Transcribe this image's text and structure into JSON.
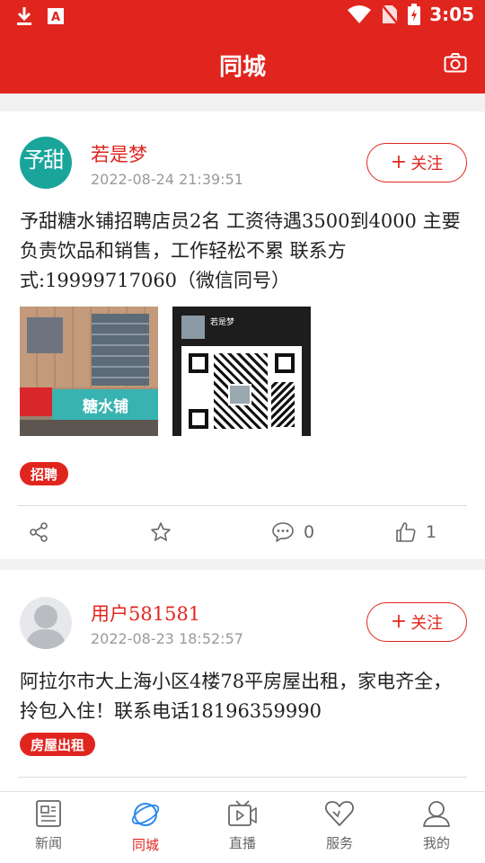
{
  "status_bar": {
    "time": "3:05"
  },
  "header": {
    "title": "同城"
  },
  "posts": [
    {
      "username": "若是梦",
      "time": "2022-08-24 21:39:51",
      "follow_label": "关注",
      "content": "予甜糖水铺招聘店员2名 工资待遇3500到4000 主要负责饮品和销售，工作轻松不累 联系方式:19999717060（微信同号）",
      "avatar_text": "予甜",
      "image_sign_text": "糖水铺",
      "qr_name": "若是梦",
      "tag": "招聘",
      "comments": "0",
      "likes": "1"
    },
    {
      "username": "用户581581",
      "time": "2022-08-23 18:52:57",
      "follow_label": "关注",
      "content": "阿拉尔市大上海小区4楼78平房屋出租，家电齐全，拎包入住！联系电话18196359990",
      "tag": "房屋出租"
    }
  ],
  "tabs": [
    {
      "label": "新闻"
    },
    {
      "label": "同城"
    },
    {
      "label": "直播"
    },
    {
      "label": "服务"
    },
    {
      "label": "我的"
    }
  ],
  "colors": {
    "accent": "#e0251e",
    "background": "#f1f1f1"
  }
}
